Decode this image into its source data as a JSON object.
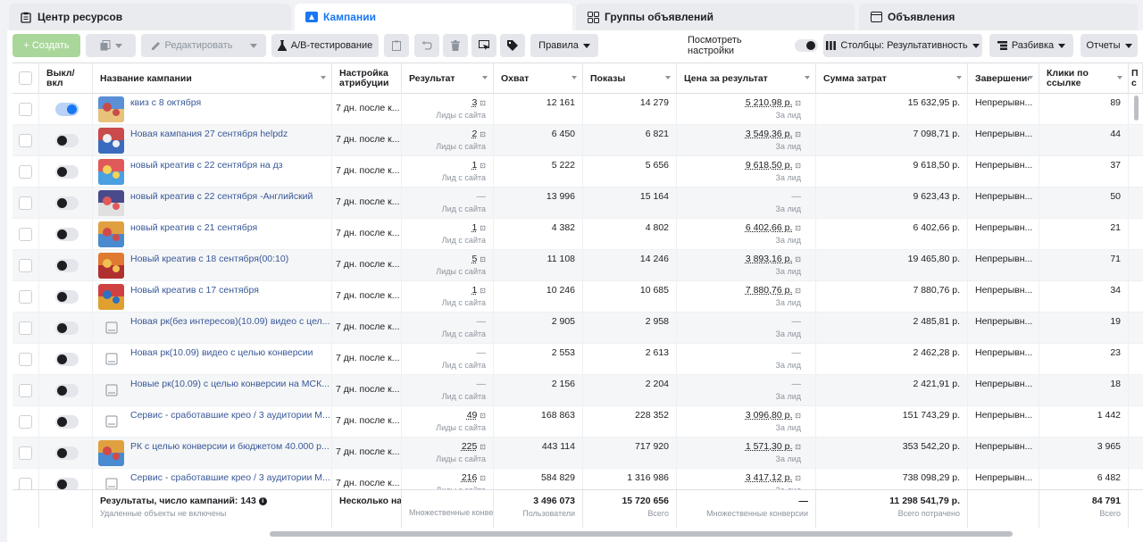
{
  "tabs": {
    "resource_center": "Центр ресурсов",
    "campaigns": "Кампании",
    "adsets": "Группы объявлений",
    "ads": "Объявления"
  },
  "toolbar": {
    "create": "+ Создать",
    "edit": "Редактировать",
    "ab_test": "A/B-тестирование",
    "rules": "Правила",
    "view_settings": "Посмотреть настройки",
    "columns": "Столбцы: Результативность",
    "breakdown": "Разбивка",
    "reports": "Отчеты"
  },
  "columns": {
    "onoff": "Выкл/\nвкл",
    "name": "Название кампании",
    "attribution": "Настройка атрибуции",
    "result": "Результат",
    "reach": "Охват",
    "impressions": "Показы",
    "cost_per_result": "Цена за результат",
    "spend": "Сумма затрат",
    "end": "Завершение",
    "link_clicks": "Клики по ссылке",
    "extra": "П с"
  },
  "rows": [
    {
      "name": "квиз с 8 октября",
      "on": true,
      "thumb": "img",
      "attr": "7 дн. после к...",
      "result": "3",
      "result_sub": "Лиды с сайта",
      "reach": "12 161",
      "impr": "14 279",
      "cpr": "5 210,98 р.",
      "cpr_sub": "За лид",
      "spend": "15 632,95 р.",
      "end": "Непрерывн...",
      "clicks": "89"
    },
    {
      "name": "Новая кампания 27 сентября helpdz",
      "on": false,
      "thumb": "img",
      "attr": "7 дн. после к...",
      "result": "2",
      "result_sub": "Лиды с сайта",
      "reach": "6 450",
      "impr": "6 821",
      "cpr": "3 549,36 р.",
      "cpr_sub": "За лид",
      "spend": "7 098,71 р.",
      "end": "Непрерывн...",
      "clicks": "44"
    },
    {
      "name": "новый креатив с 22 сентября на дз",
      "on": false,
      "thumb": "img",
      "attr": "7 дн. после к...",
      "result": "1",
      "result_sub": "Лид с сайта",
      "reach": "5 222",
      "impr": "5 656",
      "cpr": "9 618,50 р.",
      "cpr_sub": "За лид",
      "spend": "9 618,50 р.",
      "end": "Непрерывн...",
      "clicks": "37"
    },
    {
      "name": "новый креатив с 22 сентября -Английский",
      "on": false,
      "thumb": "img",
      "attr": "7 дн. после к...",
      "result": "—",
      "result_sub": "Лид с сайта",
      "reach": "13 996",
      "impr": "15 164",
      "cpr": "—",
      "cpr_sub": "За лид",
      "spend": "9 623,43 р.",
      "end": "Непрерывн...",
      "clicks": "50"
    },
    {
      "name": "новый креатив с 21 сентября",
      "on": false,
      "thumb": "img",
      "attr": "7 дн. после к...",
      "result": "1",
      "result_sub": "Лид с сайта",
      "reach": "4 382",
      "impr": "4 802",
      "cpr": "6 402,66 р.",
      "cpr_sub": "За лид",
      "spend": "6 402,66 р.",
      "end": "Непрерывн...",
      "clicks": "21"
    },
    {
      "name": "Новый креатив с 18 сентября(00:10)",
      "on": false,
      "thumb": "img",
      "attr": "7 дн. после к...",
      "result": "5",
      "result_sub": "Лиды с сайта",
      "reach": "11 108",
      "impr": "14 246",
      "cpr": "3 893,16 р.",
      "cpr_sub": "За лид",
      "spend": "19 465,80 р.",
      "end": "Непрерывн...",
      "clicks": "71"
    },
    {
      "name": "Новый креатив с 17 сентября",
      "on": false,
      "thumb": "img",
      "attr": "7 дн. после к...",
      "result": "1",
      "result_sub": "Лид с сайта",
      "reach": "10 246",
      "impr": "10 685",
      "cpr": "7 880,76 р.",
      "cpr_sub": "За лид",
      "spend": "7 880,76 р.",
      "end": "Непрерывн...",
      "clicks": "34"
    },
    {
      "name": "Новая рк(без интересов)(10.09) видео с цел...",
      "on": false,
      "thumb": "ph",
      "attr": "7 дн. после к...",
      "result": "—",
      "result_sub": "Лид с сайта",
      "reach": "2 905",
      "impr": "2 958",
      "cpr": "—",
      "cpr_sub": "За лид",
      "spend": "2 485,81 р.",
      "end": "Непрерывн...",
      "clicks": "19"
    },
    {
      "name": "Новая рк(10.09) видео с целью конверсии",
      "on": false,
      "thumb": "ph",
      "attr": "7 дн. после к...",
      "result": "—",
      "result_sub": "Лид с сайта",
      "reach": "2 553",
      "impr": "2 613",
      "cpr": "—",
      "cpr_sub": "За лид",
      "spend": "2 462,28 р.",
      "end": "Непрерывн...",
      "clicks": "23"
    },
    {
      "name": "Новые рк(10.09) с целью конверсии на МСК...",
      "on": false,
      "thumb": "ph",
      "attr": "7 дн. после к...",
      "result": "—",
      "result_sub": "Лид с сайта",
      "reach": "2 156",
      "impr": "2 204",
      "cpr": "—",
      "cpr_sub": "За лид",
      "spend": "2 421,91 р.",
      "end": "Непрерывн...",
      "clicks": "18"
    },
    {
      "name": "Сервис - сработавшие крео / 3 аудитории М...",
      "on": false,
      "thumb": "ph",
      "attr": "7 дн. после к...",
      "result": "49",
      "result_sub": "Лиды с сайта",
      "reach": "168 863",
      "impr": "228 352",
      "cpr": "3 096,80 р.",
      "cpr_sub": "За лид",
      "spend": "151 743,29 р.",
      "end": "Непрерывн...",
      "clicks": "1 442"
    },
    {
      "name": "РК с целью конверсии и бюджетом 40.000 р...",
      "on": false,
      "thumb": "img",
      "attr": "7 дн. после к...",
      "result": "225",
      "result_sub": "Лиды с сайта",
      "reach": "443 114",
      "impr": "717 920",
      "cpr": "1 571,30 р.",
      "cpr_sub": "За лид",
      "spend": "353 542,20 р.",
      "end": "Непрерывн...",
      "clicks": "3 965"
    },
    {
      "name": "Сервис - сработавшие крео / 3 аудитории М...",
      "on": false,
      "thumb": "ph",
      "attr": "7 дн. после к...",
      "result": "216",
      "result_sub": "Лиды с сайта",
      "reach": "584 829",
      "impr": "1 316 986",
      "cpr": "3 417,12 р.",
      "cpr_sub": "За лид",
      "spend": "738 098,29 р.",
      "end": "Непрерывн...",
      "clicks": "6 482"
    }
  ],
  "footer": {
    "label": "Результаты, число кампаний: 143",
    "label_sub": "Удаленные объекты не включены",
    "attr": "Несколько на...",
    "result_sub": "Множественные конве",
    "reach": "3 496 073",
    "reach_sub": "Пользователи",
    "impr": "15 720 656",
    "impr_sub": "Всего",
    "cpr": "—",
    "cpr_sub": "Множественные конверсии",
    "spend": "11 298 541,79 р.",
    "spend_sub": "Всего потрачено",
    "clicks": "84 791",
    "clicks_sub": "Всего"
  },
  "colors": {
    "accent": "#1877f2",
    "link": "#385898",
    "create_button": "#a9d79a"
  }
}
